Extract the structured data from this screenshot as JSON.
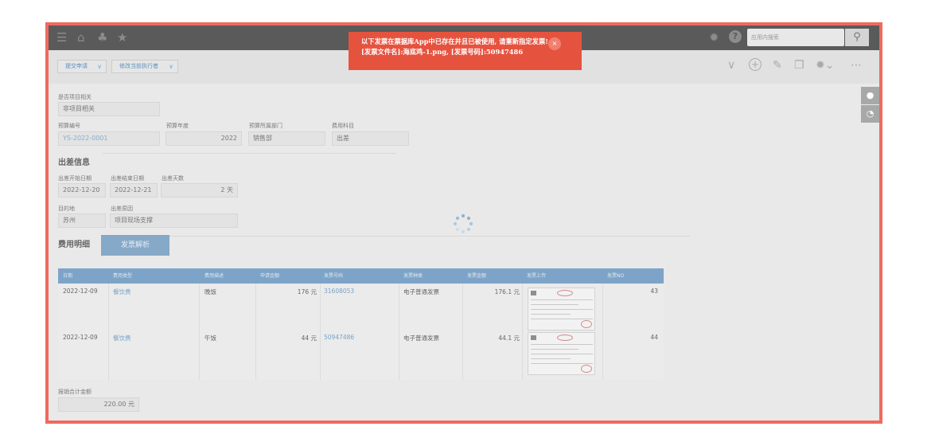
{
  "topbar": {
    "icons": [
      "menu-icon",
      "home-icon",
      "bell-icon",
      "star-icon",
      "gear-icon",
      "help-icon",
      "search-icon"
    ],
    "search_placeholder": "应用内搜索"
  },
  "toolbar": {
    "submit_label": "提交申请",
    "change_executor_label": "修改当前执行者"
  },
  "toast": {
    "line1": "以下发票在票据库App中已存在并且已被使用, 请重新指定发票!",
    "line2": "[发票文件名]:海底鸡-1.png, [发票号码]:50947486",
    "close": "×"
  },
  "form": {
    "is_project_label": "是否项目相关",
    "is_project_value": "非项目相关",
    "budget_no_label": "预算编号",
    "budget_no_value": "YS-2022-0001",
    "budget_year_label": "预算年度",
    "budget_year_value": "2022",
    "budget_dept_label": "预算所属部门",
    "budget_dept_value": "销售部",
    "cost_subject_label": "费用科目",
    "cost_subject_value": "出差"
  },
  "trip": {
    "section_title": "出差信息",
    "start_label": "出差开始日期",
    "start_value": "2022-12-20",
    "end_label": "出差结束日期",
    "end_value": "2022-12-21",
    "days_label": "出差天数",
    "days_value": "2 天",
    "dest_label": "目的地",
    "dest_value": "苏州",
    "reason_label": "出差原因",
    "reason_value": "项目现场支撑"
  },
  "expense": {
    "section_title": "费用明细",
    "parse_button": "发票解析",
    "columns": [
      "日期",
      "费用类型",
      "费用描述",
      "申请金额",
      "发票号码",
      "发票种类",
      "发票金额",
      "发票上传",
      "发票NO"
    ],
    "rows": [
      {
        "date": "2022-12-09",
        "type": "餐饮费",
        "desc": "晚饭",
        "amount": "176 元",
        "invoice_no": "31608053",
        "kind": "电子普通发票",
        "invoice_amount": "176.1 元",
        "no": "43"
      },
      {
        "date": "2022-12-09",
        "type": "餐饮费",
        "desc": "午饭",
        "amount": "44 元",
        "invoice_no": "50947486",
        "kind": "电子普通发票",
        "invoice_amount": "44.1 元",
        "no": "44"
      }
    ]
  },
  "total": {
    "label": "报销合计金额",
    "value": "220.00 元"
  },
  "colors": {
    "frame_border": "#f0695f",
    "toast_bg": "#e5533f",
    "table_header": "#7da4c8",
    "link": "#7aa2c8"
  }
}
